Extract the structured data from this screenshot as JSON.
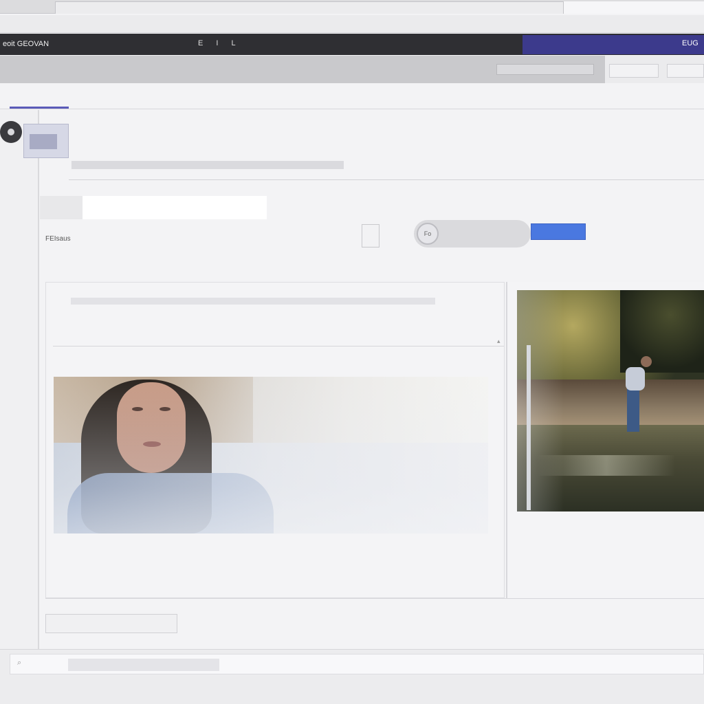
{
  "browser": {
    "left_text": "",
    "active_tab_title": "",
    "toolbar_items": [
      "",
      "",
      "",
      "",
      "",
      ""
    ]
  },
  "topbar": {
    "brand": "eoit GEOVAN",
    "brand_sub": "",
    "glyphs": "Ε Ι L",
    "mid_text": "",
    "promo_text": "",
    "promo_end": "EUG"
  },
  "subbar": {
    "items": [
      "",
      "",
      ""
    ],
    "box_text": "",
    "right_buttons": [
      "",
      ""
    ]
  },
  "nav": {
    "tabs": [
      "",
      "",
      "",
      "",
      "",
      "",
      "",
      "",
      "",
      "",
      "",
      "",
      ""
    ]
  },
  "header": {
    "line1": "",
    "line2": "",
    "line3": ""
  },
  "form": {
    "caption": "",
    "input_label": "",
    "input_value": "",
    "filter_prefix": "FEIsaus",
    "filter_link": "",
    "subline": "",
    "tiny_icon_label": "",
    "pill_circle": "Fo",
    "pill_text": "",
    "blue_button": "",
    "mini": ""
  },
  "longrow": {
    "left": "",
    "right": ""
  },
  "card": {
    "line1": "",
    "line2": "",
    "section_label": "",
    "chevron": "▴"
  },
  "bottom": {
    "label": "",
    "tabs": [
      "",
      "",
      ""
    ]
  },
  "footer": {
    "label": "",
    "search_icon": "search-icon",
    "search_value": ""
  },
  "colors": {
    "accent_purple": "#3c3a8c",
    "accent_blue": "#4a78e0",
    "dark_bar": "#2f2f33"
  }
}
